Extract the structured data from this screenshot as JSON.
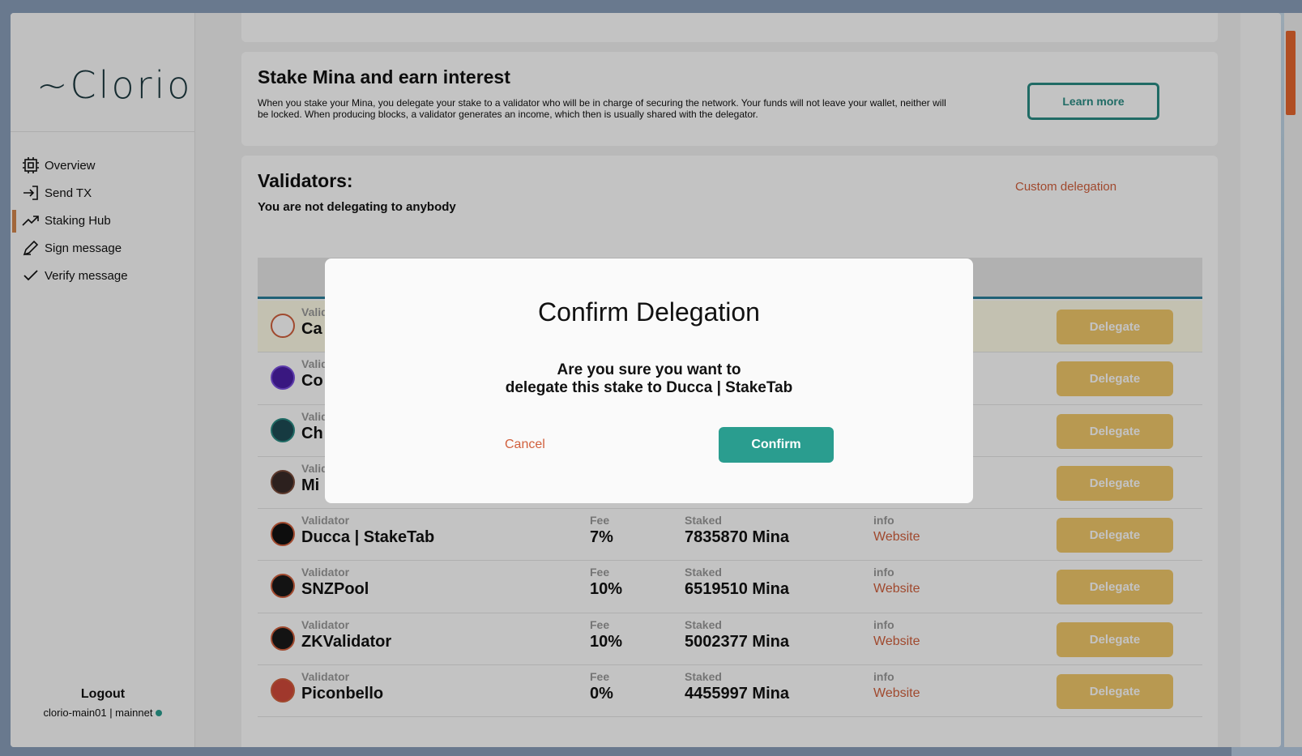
{
  "sidebar": {
    "logo": "~Clorio",
    "items": [
      {
        "label": "Overview",
        "icon": "chip-icon"
      },
      {
        "label": "Send TX",
        "icon": "send-icon"
      },
      {
        "label": "Staking Hub",
        "icon": "trending-up-icon"
      },
      {
        "label": "Sign message",
        "icon": "pen-icon"
      },
      {
        "label": "Verify message",
        "icon": "check-icon"
      }
    ],
    "logout": "Logout",
    "wallet": "clorio-main01 | mainnet"
  },
  "stake_card": {
    "title": "Stake Mina and earn interest",
    "description": "When you stake your Mina, you delegate your stake to a validator who will be in charge of securing the network. Your funds will not leave your wallet, neither will be locked. When producing blocks, a validator generates an income, which then is usually shared with the delegator.",
    "learn_more": "Learn more"
  },
  "validators": {
    "title": "Validators:",
    "subtitle": "You are not delegating to anybody",
    "custom_delegation": "Custom delegation",
    "labels": {
      "validator": "Validator",
      "fee": "Fee",
      "staked": "Staked",
      "info": "info",
      "website": "Website",
      "delegate": "Delegate"
    },
    "rows": [
      {
        "name": "Ca",
        "fee": "",
        "staked": "",
        "color": "#ffffff",
        "border": "#d1603d"
      },
      {
        "name": "Co",
        "fee": "",
        "staked": "",
        "color": "#4b1fa8",
        "border": "#7a4fe0"
      },
      {
        "name": "Ch",
        "fee": "",
        "staked": "",
        "color": "#1e4c56",
        "border": "#2a8d84"
      },
      {
        "name": "Mi",
        "fee": "",
        "staked": "",
        "color": "#3a2a28",
        "border": "#7a4b3a"
      },
      {
        "name": "Ducca | StakeTab",
        "fee": "7%",
        "staked": "7835870 Mina",
        "color": "#111111",
        "border": "#d1603d"
      },
      {
        "name": "SNZPool",
        "fee": "10%",
        "staked": "6519510 Mina",
        "color": "#1a1a1a",
        "border": "#d1603d"
      },
      {
        "name": "ZKValidator",
        "fee": "10%",
        "staked": "5002377 Mina",
        "color": "#1a1a1a",
        "border": "#d1603d"
      },
      {
        "name": "Piconbello",
        "fee": "0%",
        "staked": "4455997 Mina",
        "color": "#d14a3a",
        "border": "#d1603d"
      }
    ]
  },
  "modal": {
    "title": "Confirm Delegation",
    "question_line1": "Are you sure you want to",
    "question_line2": "delegate this stake to Ducca | StakeTab",
    "cancel": "Cancel",
    "confirm": "Confirm"
  },
  "colors": {
    "accent": "#2a9d8f",
    "link": "#d1603d",
    "delegate_button": "#f1c86a",
    "active_marker": "#d4874e"
  }
}
